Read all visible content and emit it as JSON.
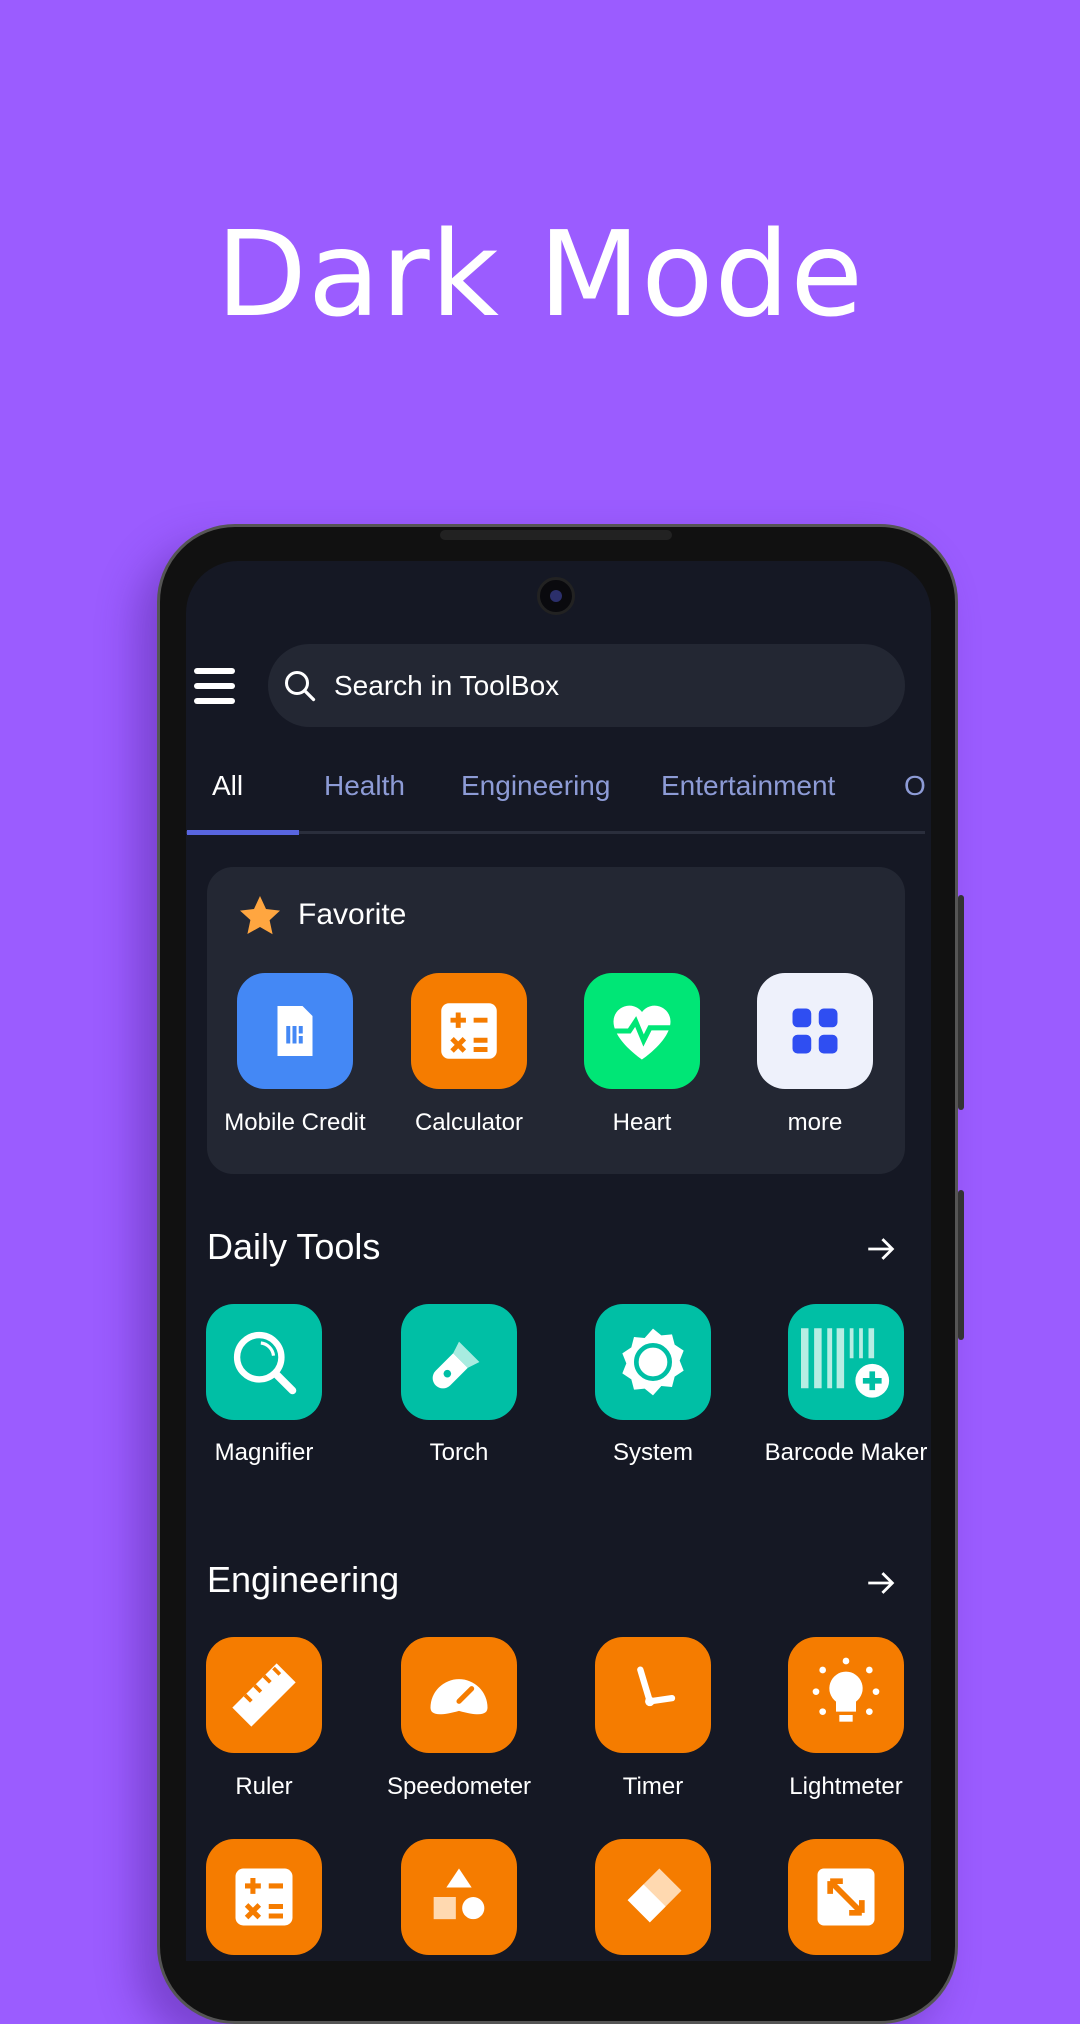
{
  "headline": "Dark Mode",
  "search": {
    "placeholder": "Search in ToolBox"
  },
  "tabs": [
    {
      "label": "All",
      "active": true
    },
    {
      "label": "Health"
    },
    {
      "label": "Engineering"
    },
    {
      "label": "Entertainment"
    },
    {
      "label": "O"
    }
  ],
  "favorite": {
    "title": "Favorite",
    "items": [
      {
        "label": "Mobile Credit",
        "icon": "sim-card-icon",
        "color": "#4488f5"
      },
      {
        "label": "Calculator",
        "icon": "calculator-icon",
        "color": "#f57c00"
      },
      {
        "label": "Heart",
        "icon": "heart-pulse-icon",
        "color": "#00e676"
      },
      {
        "label": "more",
        "icon": "grid-icon",
        "color": "#eef1fb"
      }
    ]
  },
  "daily_tools": {
    "title": "Daily Tools",
    "items": [
      {
        "label": "Magnifier",
        "icon": "magnifier-icon"
      },
      {
        "label": "Torch",
        "icon": "torch-icon"
      },
      {
        "label": "System",
        "icon": "system-gear-icon"
      },
      {
        "label": "Barcode Maker",
        "icon": "barcode-plus-icon"
      }
    ]
  },
  "engineering": {
    "title": "Engineering",
    "items": [
      {
        "label": "Ruler",
        "icon": "ruler-icon"
      },
      {
        "label": "Speedometer",
        "icon": "speedometer-icon"
      },
      {
        "label": "Timer",
        "icon": "clock-icon"
      },
      {
        "label": "Lightmeter",
        "icon": "lightbulb-icon"
      }
    ],
    "row2_icons": [
      "calculator-icon",
      "shapes-icon",
      "eraser-icon",
      "resize-icon"
    ]
  },
  "colors": {
    "background": "#9b5cff",
    "screen": "#151824",
    "card": "#232733",
    "accent": "#5865e0",
    "teal": "#00bfa5",
    "orange": "#f57c00"
  }
}
